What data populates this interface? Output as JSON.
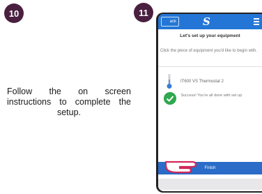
{
  "steps": [
    {
      "number": "10"
    },
    {
      "number": "11"
    }
  ],
  "instruction": "Follow the on screen instructions to complete the setup.",
  "app": {
    "back_label": "ack",
    "logo": "S",
    "title": "Let's set up your equipment",
    "description": "Click the piece of equipment you'd like to begin with.",
    "device_name": "IT600 VS Thermostat 2",
    "success_message": "Success! You're all done with set up.",
    "finish_label": "Finish"
  },
  "colors": {
    "badge": "#4a2040",
    "app_bar": "#2376d6",
    "finish": "#2a6cc8",
    "success": "#2fa84f"
  }
}
